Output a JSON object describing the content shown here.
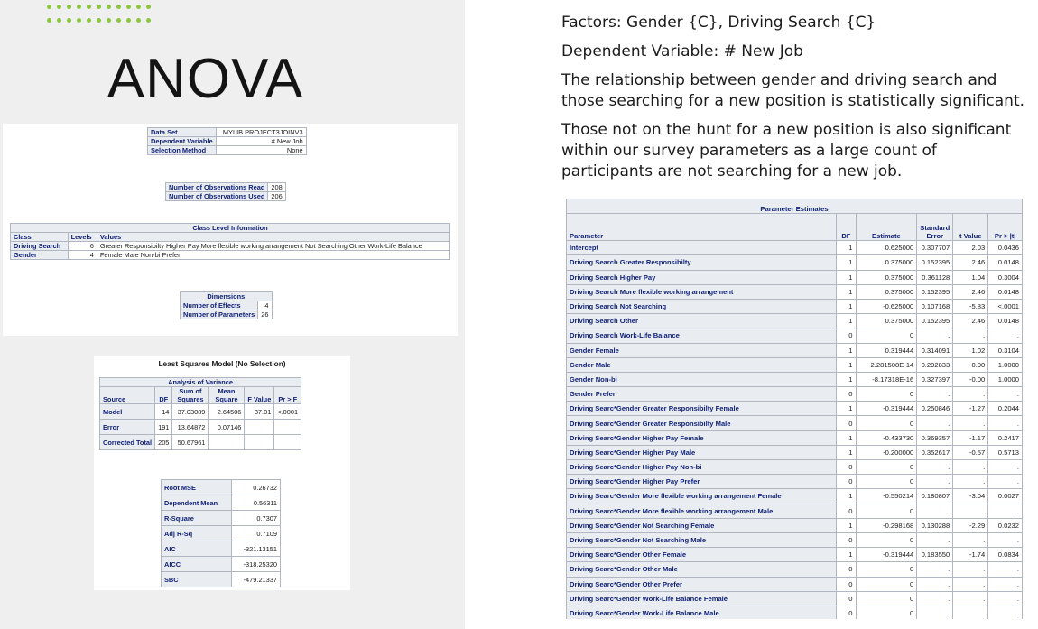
{
  "slide": {
    "title": "ANOVA"
  },
  "model_info": [
    {
      "label": "Data Set",
      "value": "MYLIB.PROJECT3JOINV3"
    },
    {
      "label": "Dependent Variable",
      "value": "# New Job"
    },
    {
      "label": "Selection Method",
      "value": "None"
    }
  ],
  "observations": [
    {
      "label": "Number of Observations Read",
      "value": "208"
    },
    {
      "label": "Number of Observations Used",
      "value": "206"
    }
  ],
  "class_level": {
    "caption": "Class Level Information",
    "headers": [
      "Class",
      "Levels",
      "Values"
    ],
    "rows": [
      [
        "Driving Search",
        "6",
        "Greater Responsibilty Higher Pay More flexible working arrangement Not Searching Other Work-Life Balance"
      ],
      [
        "Gender",
        "4",
        "Female Male Non-bi Prefer"
      ]
    ]
  },
  "dimensions": {
    "caption": "Dimensions",
    "rows": [
      [
        "Number of Effects",
        "4"
      ],
      [
        "Number of Parameters",
        "26"
      ]
    ]
  },
  "ls_model": {
    "title": "Least Squares Model (No Selection)",
    "caption": "Analysis of Variance",
    "headers": [
      "Source",
      "DF",
      "Sum of Squares",
      "Mean Square",
      "F Value",
      "Pr > F"
    ],
    "rows": [
      [
        "Model",
        "14",
        "37.03089",
        "2.64506",
        "37.01",
        "<.0001"
      ],
      [
        "Error",
        "191",
        "13.64872",
        "0.07146",
        "",
        ""
      ],
      [
        "Corrected Total",
        "205",
        "50.67961",
        "",
        "",
        ""
      ]
    ]
  },
  "fit_stats": [
    [
      "Root MSE",
      "0.26732"
    ],
    [
      "Dependent Mean",
      "0.56311"
    ],
    [
      "R-Square",
      "0.7307"
    ],
    [
      "Adj R-Sq",
      "0.7109"
    ],
    [
      "AIC",
      "-321.13151"
    ],
    [
      "AICC",
      "-318.25320"
    ],
    [
      "SBC",
      "-479.21337"
    ]
  ],
  "notes": {
    "factors": "Factors: Gender {C}, Driving Search {C}",
    "dependent": "Dependent Variable: # New Job",
    "para1": "The relationship between gender and driving search and those searching for a new position is statistically significant.",
    "para2": "Those not on the hunt for a new position is also significant within our survey parameters as a large count of participants are not searching for a new job."
  },
  "parameter_estimates": {
    "caption": "Parameter Estimates",
    "headers": [
      "Parameter",
      "DF",
      "Estimate",
      "Standard Error",
      "t Value",
      "Pr > |t|"
    ],
    "rows": [
      [
        "Intercept",
        "1",
        "0.625000",
        "0.307707",
        "2.03",
        "0.0436"
      ],
      [
        "Driving Search Greater Responsibilty",
        "1",
        "0.375000",
        "0.152395",
        "2.46",
        "0.0148"
      ],
      [
        "Driving Search Higher Pay",
        "1",
        "0.375000",
        "0.361128",
        "1.04",
        "0.3004"
      ],
      [
        "Driving Search More flexible working arrangement",
        "1",
        "0.375000",
        "0.152395",
        "2.46",
        "0.0148"
      ],
      [
        "Driving Search Not Searching",
        "1",
        "-0.625000",
        "0.107168",
        "-5.83",
        "<.0001"
      ],
      [
        "Driving Search Other",
        "1",
        "0.375000",
        "0.152395",
        "2.46",
        "0.0148"
      ],
      [
        "Driving Search Work-Life Balance",
        "0",
        "0",
        ".",
        ".",
        "."
      ],
      [
        "Gender Female",
        "1",
        "0.319444",
        "0.314091",
        "1.02",
        "0.3104"
      ],
      [
        "Gender Male",
        "1",
        "2.281508E-14",
        "0.292833",
        "0.00",
        "1.0000"
      ],
      [
        "Gender Non-bi",
        "1",
        "-8.17318E-16",
        "0.327397",
        "-0.00",
        "1.0000"
      ],
      [
        "Gender Prefer",
        "0",
        "0",
        ".",
        ".",
        "."
      ],
      [
        "Driving Searc*Gender Greater Responsibilty Female",
        "1",
        "-0.319444",
        "0.250846",
        "-1.27",
        "0.2044"
      ],
      [
        "Driving Searc*Gender Greater Responsibilty Male",
        "0",
        "0",
        ".",
        ".",
        "."
      ],
      [
        "Driving Searc*Gender Higher Pay Female",
        "1",
        "-0.433730",
        "0.369357",
        "-1.17",
        "0.2417"
      ],
      [
        "Driving Searc*Gender Higher Pay Male",
        "1",
        "-0.200000",
        "0.352617",
        "-0.57",
        "0.5713"
      ],
      [
        "Driving Searc*Gender Higher Pay Non-bi",
        "0",
        "0",
        ".",
        ".",
        "."
      ],
      [
        "Driving Searc*Gender Higher Pay Prefer",
        "0",
        "0",
        ".",
        ".",
        "."
      ],
      [
        "Driving Searc*Gender More flexible working arrangement Female",
        "1",
        "-0.550214",
        "0.180807",
        "-3.04",
        "0.0027"
      ],
      [
        "Driving Searc*Gender More flexible working arrangement Male",
        "0",
        "0",
        ".",
        ".",
        "."
      ],
      [
        "Driving Searc*Gender Not Searching Female",
        "1",
        "-0.298168",
        "0.130288",
        "-2.29",
        "0.0232"
      ],
      [
        "Driving Searc*Gender Not Searching Male",
        "0",
        "0",
        ".",
        ".",
        "."
      ],
      [
        "Driving Searc*Gender Other Female",
        "1",
        "-0.319444",
        "0.183550",
        "-1.74",
        "0.0834"
      ],
      [
        "Driving Searc*Gender Other Male",
        "0",
        "0",
        ".",
        ".",
        "."
      ],
      [
        "Driving Searc*Gender Other Prefer",
        "0",
        "0",
        ".",
        ".",
        "."
      ],
      [
        "Driving Searc*Gender Work-Life Balance Female",
        "0",
        "0",
        ".",
        ".",
        "."
      ],
      [
        "Driving Searc*Gender Work-Life Balance Male",
        "0",
        "0",
        ".",
        ".",
        "."
      ]
    ]
  }
}
